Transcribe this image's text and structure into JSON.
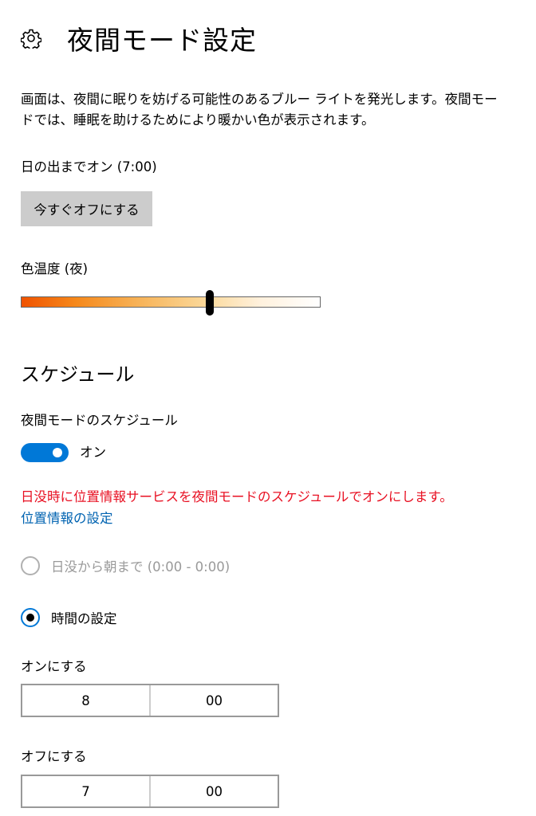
{
  "header": {
    "icon": "gear-icon",
    "title": "夜間モード設定"
  },
  "description": "画面は、夜間に眠りを妨げる可能性のあるブルー ライトを発光します。夜間モードでは、睡眠を助けるためにより暖かい色が表示されます。",
  "status_text": "日の出までオン (7:00)",
  "turn_off_button_label": "今すぐオフにする",
  "color_temperature": {
    "label": "色温度 (夜)",
    "value_fraction": 0.63
  },
  "schedule": {
    "section_title": "スケジュール",
    "label": "夜間モードのスケジュール",
    "toggle_on": true,
    "toggle_state_label": "オン",
    "warning": "日没時に位置情報サービスを夜間モードのスケジュールでオンにします。",
    "location_link": "位置情報の設定",
    "options": [
      {
        "label": "日没から朝まで (0:00 - 0:00)",
        "selected": false,
        "enabled": false
      },
      {
        "label": "時間の設定",
        "selected": true,
        "enabled": true
      }
    ],
    "turn_on": {
      "label": "オンにする",
      "hour": "8",
      "minute": "00"
    },
    "turn_off": {
      "label": "オフにする",
      "hour": "7",
      "minute": "00"
    }
  },
  "colors": {
    "accent": "#0078d7",
    "warning": "#e81123",
    "link": "#0063b1",
    "button_bg": "#cccccc"
  }
}
